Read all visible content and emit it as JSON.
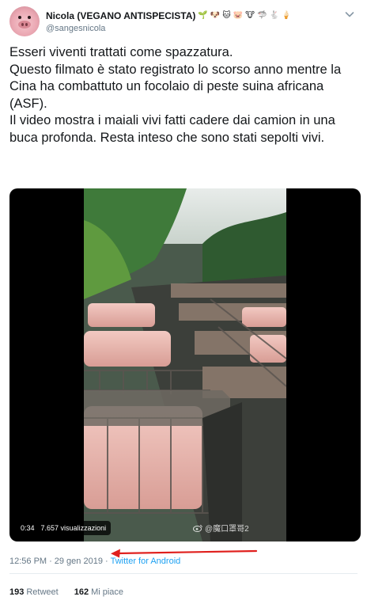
{
  "account": {
    "display_name": "Nicola (VEGANO ANTISPECISTA)",
    "emojis": [
      "🌱",
      "🐶",
      "🐱",
      "🐷",
      "🐮",
      "🦈",
      "🐇",
      "🍦"
    ],
    "handle": "@sangesnicola"
  },
  "tweet": {
    "text": "Esseri viventi trattati come spazzatura.\nQuesto filmato è stato registrato lo scorso anno mentre la Cina ha combattuto un focolaio di peste suina africana (ASF).\nIl video mostra i maiali vivi fatti cadere dai camion in una buca profonda. Resta inteso che sono stati sepolti vivi."
  },
  "media": {
    "duration": "0:34",
    "views": "7.657 visualizzazioni",
    "watermark": "@魔口罩哥2"
  },
  "meta": {
    "time": "12:56 PM",
    "separator": "·",
    "date": "29 gen 2019",
    "source": "Twitter for Android"
  },
  "stats": {
    "retweets_count": "193",
    "retweets_label": "Retweet",
    "likes_count": "162",
    "likes_label": "Mi piace"
  },
  "colors": {
    "link_blue": "#1da1f2",
    "secondary_text": "#657786",
    "annotation_arrow": "#e0201d"
  }
}
